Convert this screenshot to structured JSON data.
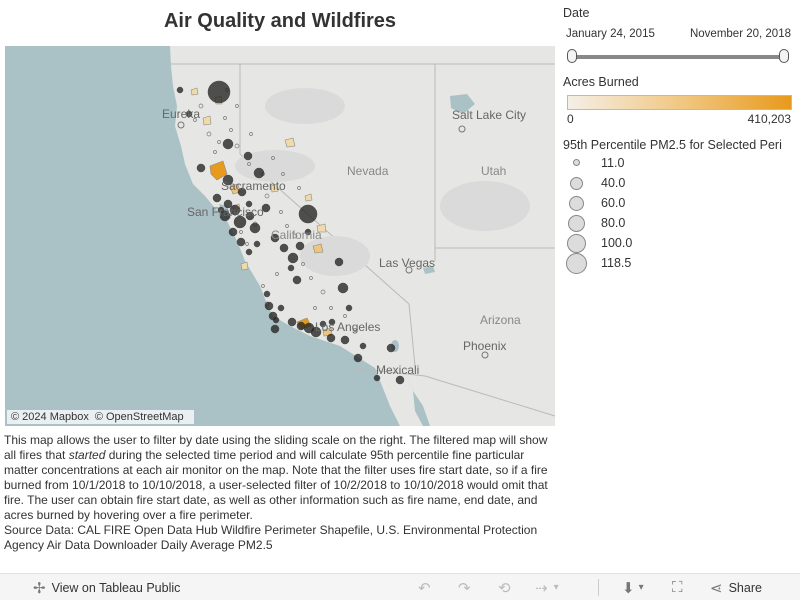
{
  "title": "Air Quality and Wildfires",
  "map": {
    "attribution": [
      "© 2024 Mapbox",
      "© OpenStreetMap"
    ],
    "labels": {
      "salt_lake_city": "Salt Lake City",
      "eureka": "Eureka",
      "nevada": "Nevada",
      "utah": "Utah",
      "sacramento": "Sacramento",
      "san_francisco": "San Francisco",
      "california": "California",
      "las_vegas": "Las Vegas",
      "arizona": "Arizona",
      "los_angeles": "Los Angeles",
      "phoenix": "Phoenix",
      "mexicali": "Mexicali"
    }
  },
  "filters": {
    "date_label": "Date",
    "date_start": "January 24, 2015",
    "date_end": "November 20, 2018",
    "date_range_selected": [
      0,
      1
    ],
    "acres_label": "Acres Burned",
    "acres_min": "0",
    "acres_max": "410,203",
    "pm_label": "95th Percentile PM2.5 for Selected Peri",
    "pm_sizes": [
      "11.0",
      "40.0",
      "60.0",
      "80.0",
      "100.0",
      "118.5"
    ]
  },
  "description": {
    "p1_a": "This map allows the user to filter by date using the sliding scale on the right. The filtered map will show all fires that ",
    "p1_em": "started",
    "p1_b": " during the selected time period and will calculate 95th percentile fine particular matter concentrations at each air monitor on the map. Note that the filter uses fire start date, so if a fire burned from 10/1/2018 to 10/10/2018, a user-selected filter of 10/2/2018 to 10/10/2018 would omit that fire.  The user can obtain fire start date, as well as other information such as fire name, end date, and acres burned by hovering over a fire perimeter.",
    "source": "Source Data: CAL FIRE Open Data Hub Wildfire Perimeter Shapefile, U.S. Environmental Protection Agency Air Data Downloader Daily Average PM2.5"
  },
  "toolbar": {
    "view_label": "View on Tableau Public",
    "share_label": "Share"
  },
  "colors": {
    "ocean": "#aac2c6",
    "land": "#e6e6e4",
    "monitor": "#222222",
    "fire_orange": "#e89a1c",
    "fire_light": "#f2d9a8"
  }
}
